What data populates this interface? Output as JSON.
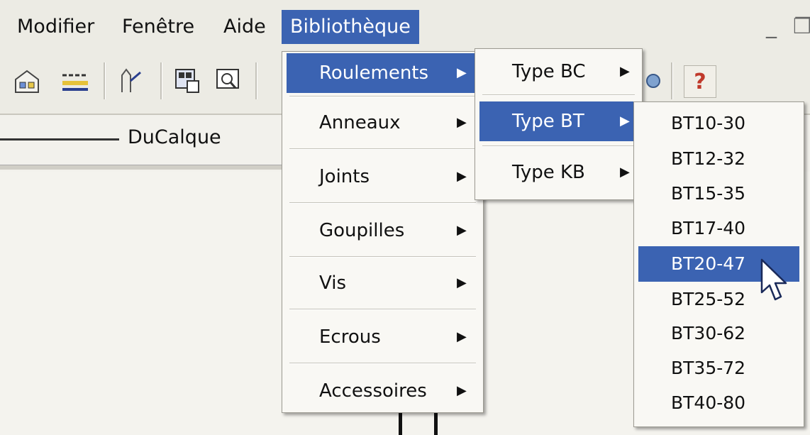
{
  "menubar": {
    "items": [
      "Modifier",
      "Fenêtre",
      "Aide",
      "Bibliothèque"
    ],
    "minimize_label": "_",
    "restore_label": "❐"
  },
  "toolbar": {
    "icons": [
      "layer-manager-icon",
      "linetype-icon",
      "match-properties-icon",
      "block-editor-icon",
      "zoom-window-icon",
      "help-icon"
    ],
    "help_label": "?"
  },
  "layer": {
    "name": "DuCalque"
  },
  "bibliotheque_menu": {
    "items": [
      "Roulements",
      "Anneaux",
      "Joints",
      "Goupilles",
      "Vis",
      "Ecrous",
      "Accessoires"
    ],
    "selected": "Roulements"
  },
  "roulements_menu": {
    "items": [
      "Type BC",
      "Type BT",
      "Type KB"
    ],
    "selected": "Type BT"
  },
  "type_bt_menu": {
    "items": [
      "BT10-30",
      "BT12-32",
      "BT15-35",
      "BT17-40",
      "BT20-47",
      "BT25-52",
      "BT30-62",
      "BT35-72",
      "BT40-80"
    ],
    "selected": "BT20-47"
  },
  "colors": {
    "highlight": "#3b63b2",
    "menu_bg": "#f9f8f4",
    "chrome": "#ecebe4"
  },
  "arrow_glyph": "▶"
}
